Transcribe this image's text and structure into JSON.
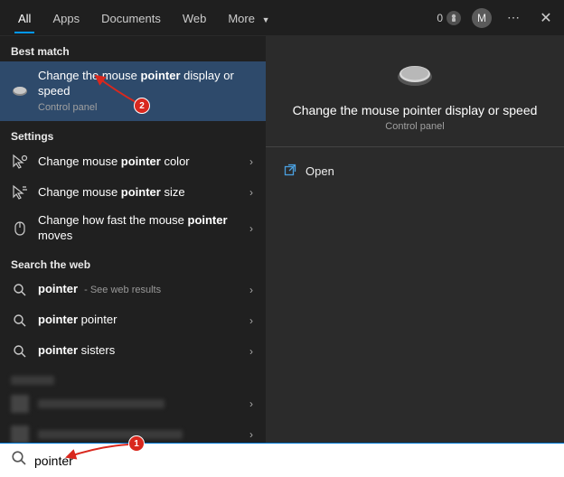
{
  "tabs": {
    "all": "All",
    "apps": "Apps",
    "documents": "Documents",
    "web": "Web",
    "more": "More"
  },
  "topright": {
    "rewards_count": "0",
    "avatar_initial": "M"
  },
  "groups": {
    "best_match": "Best match",
    "settings": "Settings",
    "search_web": "Search the web"
  },
  "best_match": {
    "title_pre": "Change the mouse ",
    "title_bold": "pointer",
    "title_post": " display or speed",
    "subtitle": "Control panel"
  },
  "settings_items": [
    {
      "pre": "Change mouse ",
      "bold": "pointer",
      "post": " color"
    },
    {
      "pre": "Change mouse ",
      "bold": "pointer",
      "post": " size"
    },
    {
      "pre": "Change how fast the mouse ",
      "bold": "pointer",
      "post": " moves"
    }
  ],
  "web_items": [
    {
      "bold": "pointer",
      "sub": " - See web results"
    },
    {
      "bold": "pointer",
      "post": " pointer"
    },
    {
      "bold": "pointer",
      "post": " sisters"
    }
  ],
  "preview": {
    "title": "Change the mouse pointer display or speed",
    "subtitle": "Control panel",
    "open": "Open"
  },
  "search": {
    "value": "pointer"
  },
  "callouts": {
    "one": "1",
    "two": "2"
  }
}
